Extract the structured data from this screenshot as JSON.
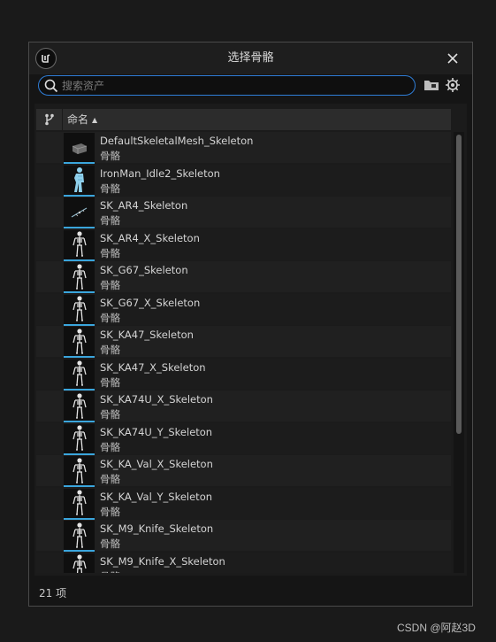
{
  "dialog": {
    "title": "选择骨骼",
    "search": {
      "placeholder": "搜索资产",
      "value": ""
    },
    "header": {
      "name_column": "命名",
      "sort": "ascending"
    },
    "assets": [
      {
        "name": "DefaultSkeletalMesh_Skeleton",
        "type": "骨骼",
        "thumb": "mesh-block-icon"
      },
      {
        "name": "IronMan_Idle2_Skeleton",
        "type": "骨骼",
        "thumb": "ironman-mesh-icon"
      },
      {
        "name": "SK_AR4_Skeleton",
        "type": "骨骼",
        "thumb": "rifle-skeleton-icon"
      },
      {
        "name": "SK_AR4_X_Skeleton",
        "type": "骨骼",
        "thumb": "humanoid-skeleton-icon"
      },
      {
        "name": "SK_G67_Skeleton",
        "type": "骨骼",
        "thumb": "humanoid-skeleton-icon"
      },
      {
        "name": "SK_G67_X_Skeleton",
        "type": "骨骼",
        "thumb": "humanoid-skeleton-icon"
      },
      {
        "name": "SK_KA47_Skeleton",
        "type": "骨骼",
        "thumb": "humanoid-skeleton-icon"
      },
      {
        "name": "SK_KA47_X_Skeleton",
        "type": "骨骼",
        "thumb": "humanoid-skeleton-icon"
      },
      {
        "name": "SK_KA74U_X_Skeleton",
        "type": "骨骼",
        "thumb": "humanoid-skeleton-icon"
      },
      {
        "name": "SK_KA74U_Y_Skeleton",
        "type": "骨骼",
        "thumb": "humanoid-skeleton-icon"
      },
      {
        "name": "SK_KA_Val_X_Skeleton",
        "type": "骨骼",
        "thumb": "humanoid-skeleton-icon"
      },
      {
        "name": "SK_KA_Val_Y_Skeleton",
        "type": "骨骼",
        "thumb": "humanoid-skeleton-icon"
      },
      {
        "name": "SK_M9_Knife_Skeleton",
        "type": "骨骼",
        "thumb": "humanoid-skeleton-icon"
      },
      {
        "name": "SK_M9_Knife_X_Skeleton",
        "type": "骨骼",
        "thumb": "humanoid-skeleton-icon"
      }
    ],
    "status": "21 项"
  },
  "watermark": "CSDN @阿赵3D",
  "colors": {
    "accent": "#2f7dd6",
    "thumb_underline": "#3aa5dc",
    "background": "#151515"
  }
}
